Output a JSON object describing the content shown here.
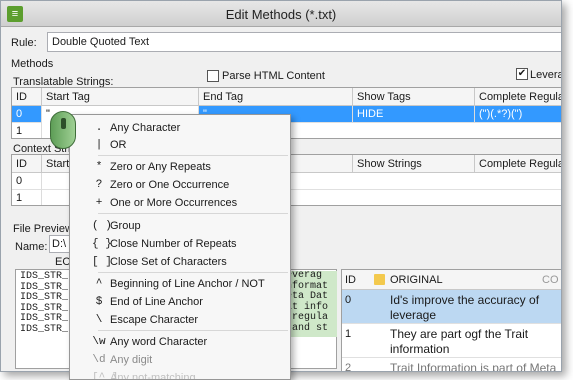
{
  "window": {
    "title": "Edit Methods (*.txt)",
    "icon_label": "≡"
  },
  "rule": {
    "label": "Rule:",
    "value": "Double Quoted Text"
  },
  "methods_label": "Methods",
  "translatable": {
    "label": "Translatable Strings:",
    "parse_html_label": "Parse HTML Content",
    "parse_html_checked": false,
    "leverage_label": "Leverage",
    "leverage_checked": true,
    "columns": [
      "ID",
      "Start Tag",
      "End Tag",
      "Show Tags",
      "Complete Regular Exp"
    ],
    "rows": [
      [
        "0",
        "\"",
        "\"",
        "HIDE",
        "(\")(.*?)(\")"
      ],
      [
        "1",
        "",
        "",
        "",
        ""
      ]
    ]
  },
  "context": {
    "label": "Context Strin",
    "columns": [
      "ID",
      "Start T",
      "End Tag",
      "Show Strings",
      "Complete Regular Exp"
    ],
    "rows": [
      [
        "0",
        "",
        "",
        "",
        ""
      ],
      [
        "1",
        "",
        "",
        "",
        ""
      ]
    ]
  },
  "file_preview": {
    "label": "File Preview",
    "name_label": "Name:",
    "name_value": "D:\\",
    "eol_label": "EOL",
    "lines": [
      "IDS_STR_",
      "IDS_STR_",
      "IDS_STR_",
      "IDS_STR_",
      "IDS_STR_",
      "IDS_STR_"
    ],
    "green_lines": [
      "leverag",
      "Informat",
      "Meta Dat",
      "ait info",
      "r regula",
      "d and st"
    ]
  },
  "segments": {
    "columns": [
      "ID",
      "ORIGINAL",
      "CO"
    ],
    "rows": [
      {
        "id": "0",
        "text": "Id's improve the accuracy of leverage"
      },
      {
        "id": "1",
        "text": "They are part ogf the Trait information"
      },
      {
        "id": "2",
        "text": "Trait Information is part of Meta Data"
      }
    ]
  },
  "menu": {
    "items": [
      {
        "sym": ".",
        "label": "Any Character"
      },
      {
        "sym": "|",
        "label": "OR"
      },
      {
        "sym": "*",
        "label": "Zero or Any Repeats"
      },
      {
        "sym": "?",
        "label": "Zero or One Occurrence"
      },
      {
        "sym": "+",
        "label": "One or More Occurrences"
      },
      {
        "sym": "( )",
        "label": "Group"
      },
      {
        "sym": "{ }",
        "label": "Close Number of Repeats"
      },
      {
        "sym": "[ ]",
        "label": "Close Set of Characters"
      },
      {
        "sym": "^",
        "label": "Beginning of Line Anchor / NOT"
      },
      {
        "sym": "$",
        "label": "End of Line Anchor"
      },
      {
        "sym": "\\",
        "label": "Escape Character"
      },
      {
        "sym": "\\w",
        "label": "Any word Character"
      },
      {
        "sym": "\\d",
        "label": "Any digit"
      },
      {
        "sym": "[^ ]",
        "label": "Any not-matching"
      }
    ]
  }
}
